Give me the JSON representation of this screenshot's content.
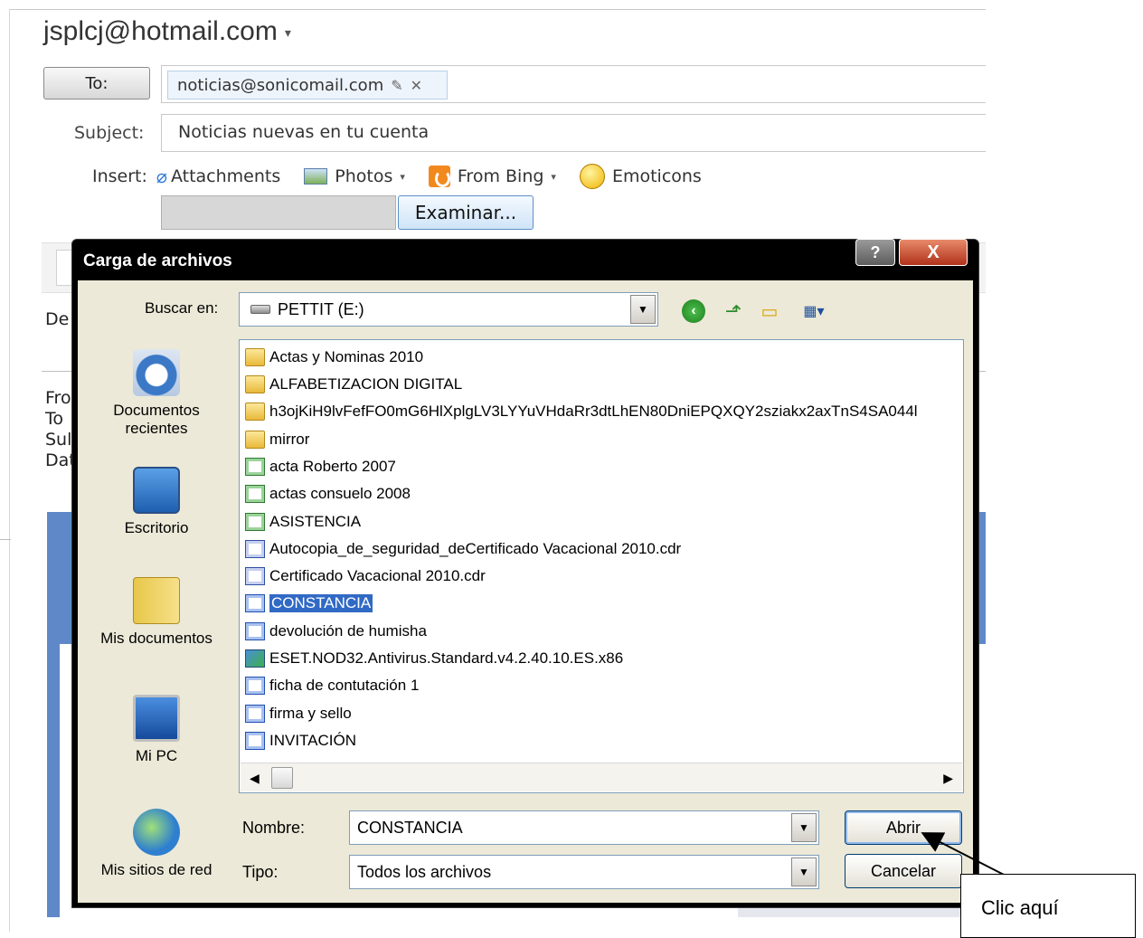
{
  "compose": {
    "account": "jsplcj@hotmail.com",
    "account_caret": "▾",
    "to_label": "To:",
    "to_recipient": "noticias@sonicomail.com",
    "subject_label": "Subject:",
    "subject_value": "Noticias nuevas en tu cuenta",
    "insert_label": "Insert:",
    "insert_attachments": "Attachments",
    "insert_photos": "Photos",
    "insert_bing": "From Bing",
    "insert_emoticons": "Emoticons",
    "browse_label": "Examinar...",
    "partial_desde": "De",
    "partial_from": "Fro",
    "partial_to": "To",
    "partial_subject": "Sul",
    "partial_date": "Dat"
  },
  "dialog": {
    "title": "Carga de archivos",
    "help_label": "?",
    "close_label": "X",
    "look_in_label": "Buscar en:",
    "look_in_value": "PETTIT (E:)",
    "places": [
      {
        "label": "Documentos recientes",
        "icon": "recent-documents-icon"
      },
      {
        "label": "Escritorio",
        "icon": "desktop-icon"
      },
      {
        "label": "Mis documentos",
        "icon": "my-documents-icon"
      },
      {
        "label": "Mi PC",
        "icon": "my-computer-icon"
      },
      {
        "label": "Mis sitios de red",
        "icon": "network-places-icon"
      }
    ],
    "files": [
      {
        "name": "Actas y Nominas 2010",
        "type": "folder"
      },
      {
        "name": "ALFABETIZACION DIGITAL",
        "type": "folder"
      },
      {
        "name": "h3ojKiH9lvFefFO0mG6HlXplgLV3LYYuVHdaRr3dtLhEN80DniEPQXQY2sziakx2axTnS4SA044l",
        "type": "folder"
      },
      {
        "name": "mirror",
        "type": "folder"
      },
      {
        "name": "acta Roberto 2007",
        "type": "excel"
      },
      {
        "name": "actas consuelo 2008",
        "type": "excel"
      },
      {
        "name": "ASISTENCIA",
        "type": "excel"
      },
      {
        "name": "Autocopia_de_seguridad_deCertificado Vacacional 2010.cdr",
        "type": "cdr"
      },
      {
        "name": "Certificado Vacacional 2010.cdr",
        "type": "cdr"
      },
      {
        "name": "CONSTANCIA",
        "type": "word",
        "selected": true
      },
      {
        "name": "devolución de humisha",
        "type": "word"
      },
      {
        "name": "ESET.NOD32.Antivirus.Standard.v4.2.40.10.ES.x86",
        "type": "installer"
      },
      {
        "name": "ficha de contutación  1",
        "type": "word"
      },
      {
        "name": "firma y sello",
        "type": "word"
      },
      {
        "name": "INVITACIÓN",
        "type": "word"
      }
    ],
    "filename_label": "Nombre:",
    "filename_value": "CONSTANCIA",
    "filetype_label": "Tipo:",
    "filetype_value": "Todos los archivos",
    "open_label": "Abrir",
    "cancel_label": "Cancelar"
  },
  "annotation": {
    "callout_text": "Clic aquí"
  }
}
